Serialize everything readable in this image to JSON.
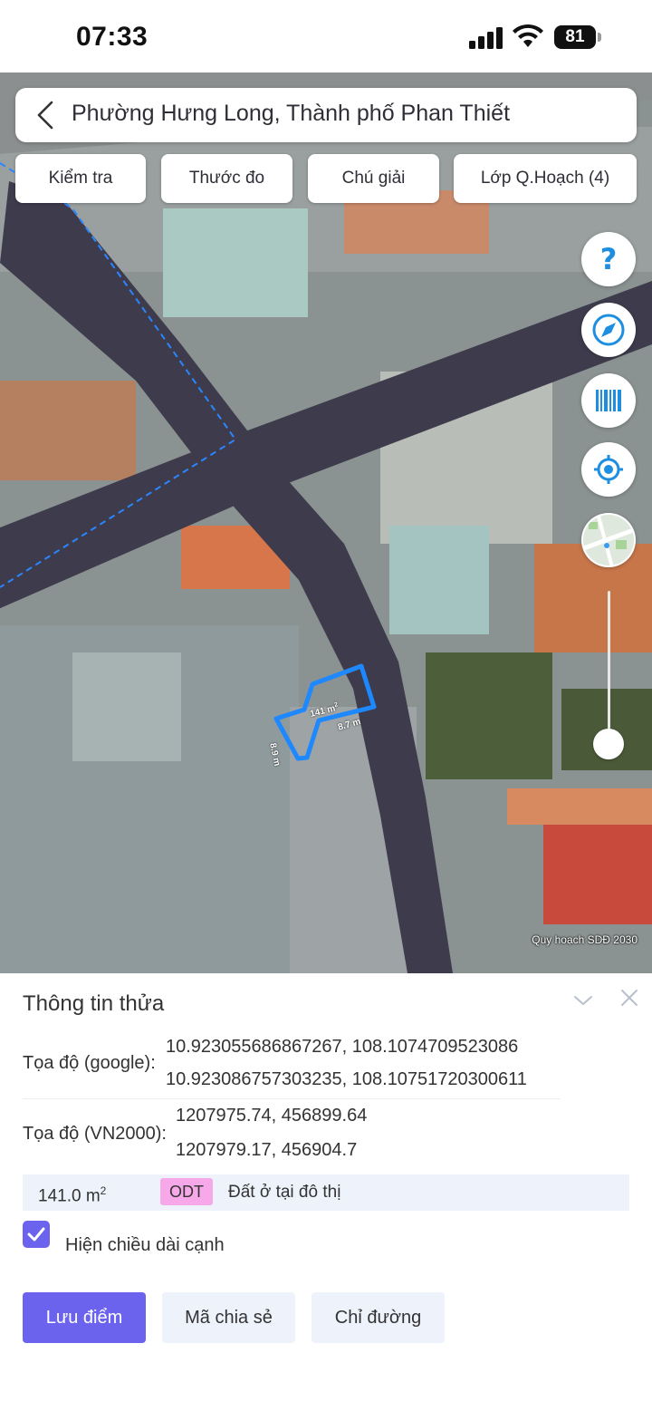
{
  "status_bar": {
    "time": "07:33",
    "battery": "81"
  },
  "map": {
    "location_title": "Phường Hưng Long, Thành phố Phan Thiết",
    "tabs": [
      {
        "label": "Kiểm tra"
      },
      {
        "label": "Thước đo"
      },
      {
        "label": "Chú giải"
      },
      {
        "label": "Lớp Q.Hoạch (4)"
      }
    ],
    "controls": {
      "help_icon": "question-mark-icon",
      "compass_icon": "compass-icon",
      "layers_icon": "barcode-icon",
      "locate_icon": "crosshair-icon",
      "basemap_icon": "map-thumbnail-icon"
    },
    "parcel": {
      "area_label": "141 m",
      "area_unit_sup": "2",
      "edge_a": "8.7 m",
      "edge_b": "8.9 m",
      "outline_color": "#1e88ff"
    },
    "attribution": "Quy hoạch SDĐ 2030"
  },
  "panel": {
    "title": "Thông tin thửa",
    "google_coords": {
      "label": "Tọa độ (google):",
      "values": [
        "10.923055686867267, 108.1074709523086",
        "10.923086757303235, 108.10751720300611"
      ]
    },
    "vn2000_coords": {
      "label": "Tọa độ (VN2000):",
      "values": [
        "1207975.74, 456899.64",
        "1207979.17, 456904.7"
      ]
    },
    "land": {
      "area": "141.0 m",
      "area_unit_sup": "2",
      "code": "ODT",
      "code_color": "#f7a8e8",
      "use": "Đất ở tại đô thị"
    },
    "show_edge_lengths": {
      "checked": true,
      "label": "Hiện chiều dài cạnh"
    },
    "buttons": {
      "save": "Lưu điểm",
      "share": "Mã chia sẻ",
      "directions": "Chỉ đường"
    },
    "accent_color": "#6b63ee"
  }
}
